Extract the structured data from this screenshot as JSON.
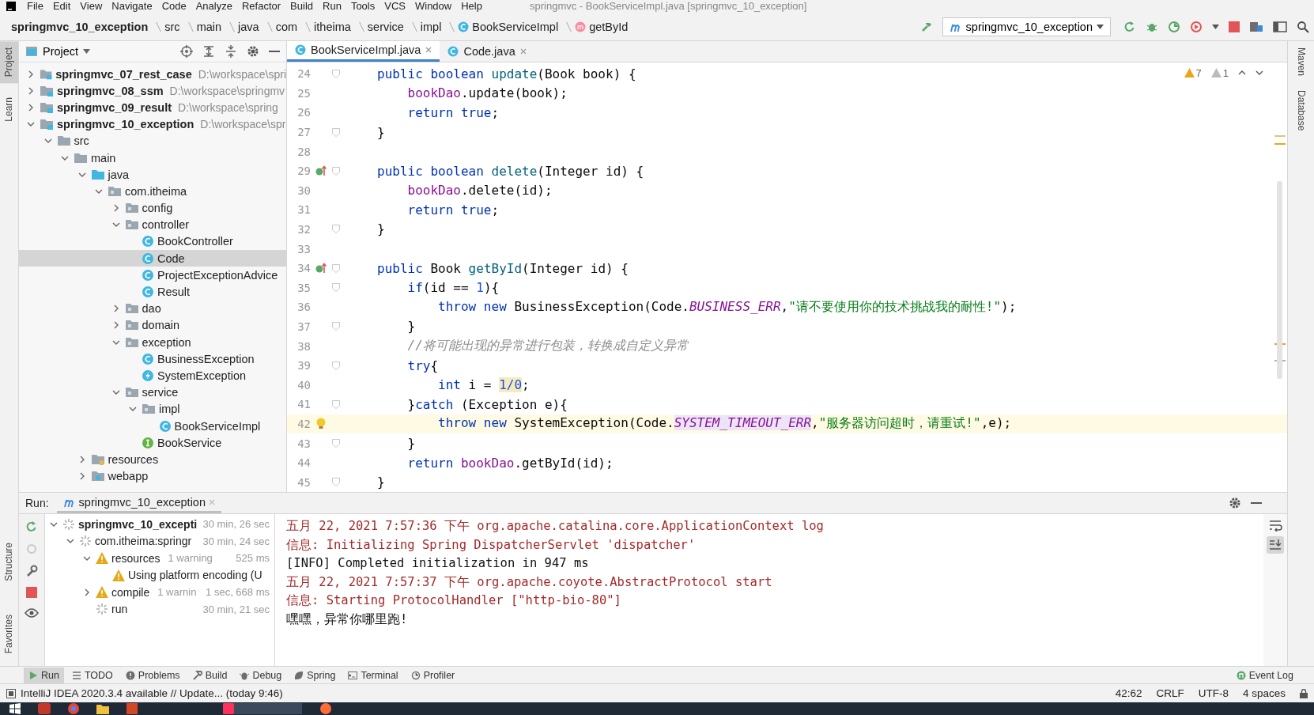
{
  "menu": {
    "items": [
      "File",
      "Edit",
      "View",
      "Navigate",
      "Code",
      "Analyze",
      "Refactor",
      "Build",
      "Run",
      "Tools",
      "VCS",
      "Window",
      "Help"
    ],
    "title": "springmvc - BookServiceImpl.java [springmvc_10_exception]"
  },
  "breadcrumbs": [
    {
      "label": "springmvc_10_exception",
      "kind": "module"
    },
    {
      "label": "src",
      "kind": "folder"
    },
    {
      "label": "main",
      "kind": "folder"
    },
    {
      "label": "java",
      "kind": "folder"
    },
    {
      "label": "com",
      "kind": "folder"
    },
    {
      "label": "itheima",
      "kind": "folder"
    },
    {
      "label": "service",
      "kind": "folder"
    },
    {
      "label": "impl",
      "kind": "folder"
    },
    {
      "label": "BookServiceImpl",
      "kind": "class"
    },
    {
      "label": "getById",
      "kind": "method"
    }
  ],
  "run_config": {
    "label": "springmvc_10_exception"
  },
  "left_tabs": [
    {
      "label": "Project",
      "selected": true
    },
    {
      "label": "Learn",
      "selected": false
    }
  ],
  "left_bottom_tabs": [
    {
      "label": "Structure",
      "selected": false
    },
    {
      "label": "Favorites",
      "selected": false
    }
  ],
  "right_tabs": [
    {
      "label": "Maven",
      "selected": false
    },
    {
      "label": "Database",
      "selected": false
    }
  ],
  "project": {
    "title": "Project",
    "tree": [
      {
        "label": "springmvc_07_rest_case",
        "path": "D:\\workspace\\spri",
        "kind": "module",
        "expanded": false,
        "selected": false
      },
      {
        "label": "springmvc_08_ssm",
        "path": "D:\\workspace\\springmv",
        "kind": "module",
        "expanded": false,
        "selected": false
      },
      {
        "label": "springmvc_09_result",
        "path": "D:\\workspace\\spring",
        "kind": "module",
        "expanded": false,
        "selected": false
      },
      {
        "label": "springmvc_10_exception",
        "path": "D:\\workspace\\spr",
        "kind": "module",
        "expanded": true,
        "selected": false,
        "children": [
          {
            "label": "src",
            "kind": "folder",
            "expanded": true,
            "selected": false,
            "children": [
              {
                "label": "main",
                "kind": "folder",
                "expanded": true,
                "selected": false,
                "children": [
                  {
                    "label": "java",
                    "kind": "source-root",
                    "expanded": true,
                    "selected": false,
                    "children": [
                      {
                        "label": "com.itheima",
                        "kind": "package",
                        "expanded": true,
                        "selected": false,
                        "children": [
                          {
                            "label": "config",
                            "kind": "package",
                            "expanded": false,
                            "selected": false
                          },
                          {
                            "label": "controller",
                            "kind": "package",
                            "expanded": true,
                            "selected": false,
                            "children": [
                              {
                                "label": "BookController",
                                "kind": "class",
                                "selected": false
                              },
                              {
                                "label": "Code",
                                "kind": "class",
                                "selected": true
                              },
                              {
                                "label": "ProjectExceptionAdvice",
                                "kind": "class",
                                "selected": false
                              },
                              {
                                "label": "Result",
                                "kind": "class",
                                "selected": false
                              }
                            ]
                          },
                          {
                            "label": "dao",
                            "kind": "package",
                            "expanded": false,
                            "selected": false
                          },
                          {
                            "label": "domain",
                            "kind": "package",
                            "expanded": false,
                            "selected": false
                          },
                          {
                            "label": "exception",
                            "kind": "package",
                            "expanded": true,
                            "selected": false,
                            "children": [
                              {
                                "label": "BusinessException",
                                "kind": "class",
                                "selected": false
                              },
                              {
                                "label": "SystemException",
                                "kind": "exception-class",
                                "selected": false
                              }
                            ]
                          },
                          {
                            "label": "service",
                            "kind": "package",
                            "expanded": true,
                            "selected": false,
                            "children": [
                              {
                                "label": "impl",
                                "kind": "package",
                                "expanded": true,
                                "selected": false,
                                "children": [
                                  {
                                    "label": "BookServiceImpl",
                                    "kind": "class",
                                    "selected": false
                                  }
                                ]
                              },
                              {
                                "label": "BookService",
                                "kind": "interface",
                                "selected": false
                              }
                            ]
                          }
                        ]
                      }
                    ]
                  },
                  {
                    "label": "resources",
                    "kind": "resources",
                    "expanded": false,
                    "selected": false
                  },
                  {
                    "label": "webapp",
                    "kind": "webapp",
                    "expanded": false,
                    "selected": false
                  }
                ]
              }
            ]
          }
        ]
      }
    ]
  },
  "editor": {
    "tabs": [
      {
        "label": "BookServiceImpl.java",
        "selected": true
      },
      {
        "label": "Code.java",
        "selected": false
      }
    ],
    "problems": {
      "warnings": "7",
      "weak_warnings": "1"
    },
    "lines": [
      {
        "no": "24",
        "fold": true,
        "current": false,
        "tokens": [
          {
            "kind": "kw",
            "text": "public boolean "
          },
          {
            "kind": "method",
            "text": "update"
          },
          {
            "kind": "plain",
            "text": "(Book book) {"
          }
        ]
      },
      {
        "no": "25",
        "fold": false,
        "current": false,
        "tokens": [
          {
            "kind": "field",
            "text": "    bookDao"
          },
          {
            "kind": "plain",
            "text": ".update(book);"
          }
        ]
      },
      {
        "no": "26",
        "fold": false,
        "current": false,
        "tokens": [
          {
            "kind": "kw",
            "text": "    return true"
          },
          {
            "kind": "plain",
            "text": ";"
          }
        ]
      },
      {
        "no": "27",
        "fold": true,
        "current": false,
        "tokens": [
          {
            "kind": "plain",
            "text": "}"
          }
        ]
      },
      {
        "no": "28",
        "fold": false,
        "current": false
      },
      {
        "no": "29",
        "fold": true,
        "current": false,
        "marker": {
          "kind": "implements"
        },
        "tokens": [
          {
            "kind": "kw",
            "text": "public boolean "
          },
          {
            "kind": "method",
            "text": "delete"
          },
          {
            "kind": "plain",
            "text": "(Integer id) {"
          }
        ]
      },
      {
        "no": "30",
        "fold": false,
        "current": false,
        "tokens": [
          {
            "kind": "field",
            "text": "    bookDao"
          },
          {
            "kind": "plain",
            "text": ".delete(id);"
          }
        ]
      },
      {
        "no": "31",
        "fold": false,
        "current": false,
        "tokens": [
          {
            "kind": "kw",
            "text": "    return true"
          },
          {
            "kind": "plain",
            "text": ";"
          }
        ]
      },
      {
        "no": "32",
        "fold": true,
        "current": false,
        "tokens": [
          {
            "kind": "plain",
            "text": "}"
          }
        ]
      },
      {
        "no": "33",
        "fold": false,
        "current": false
      },
      {
        "no": "34",
        "fold": true,
        "current": false,
        "marker": {
          "kind": "implements"
        },
        "tokens": [
          {
            "kind": "kw",
            "text": "public "
          },
          {
            "kind": "plain",
            "text": "Book "
          },
          {
            "kind": "method",
            "text": "getById"
          },
          {
            "kind": "plain",
            "text": "(Integer id) {"
          }
        ]
      },
      {
        "no": "35",
        "fold": true,
        "current": false,
        "tokens": [
          {
            "kind": "kw",
            "text": "    if"
          },
          {
            "kind": "plain",
            "text": "(id == "
          },
          {
            "kind": "num",
            "text": "1"
          },
          {
            "kind": "plain",
            "text": "){"
          }
        ]
      },
      {
        "no": "36",
        "fold": false,
        "current": false,
        "tokens": [
          {
            "kind": "kw",
            "text": "        throw new "
          },
          {
            "kind": "plain",
            "text": "BusinessException(Code."
          },
          {
            "kind": "static",
            "text": "BUSINESS_ERR"
          },
          {
            "kind": "plain",
            "text": ","
          },
          {
            "kind": "str",
            "text": "\"请不要使用你的技术挑战我的耐性!\""
          },
          {
            "kind": "plain",
            "text": ");"
          }
        ]
      },
      {
        "no": "37",
        "fold": true,
        "current": false,
        "tokens": [
          {
            "kind": "plain",
            "text": "    }"
          }
        ]
      },
      {
        "no": "38",
        "fold": false,
        "current": false,
        "tokens": [
          {
            "kind": "comment",
            "text": "    //将可能出现的异常进行包装，转换成自定义异常"
          }
        ]
      },
      {
        "no": "39",
        "fold": true,
        "current": false,
        "tokens": [
          {
            "kind": "kw",
            "text": "    try"
          },
          {
            "kind": "plain",
            "text": "{"
          }
        ]
      },
      {
        "no": "40",
        "fold": false,
        "current": false,
        "tokens": [
          {
            "kind": "kw",
            "text": "        int "
          },
          {
            "kind": "plain",
            "text": "i = "
          },
          {
            "kind": "num-warning",
            "text": "1/0"
          },
          {
            "kind": "plain",
            "text": ";"
          }
        ]
      },
      {
        "no": "41",
        "fold": true,
        "current": false,
        "tokens": [
          {
            "kind": "plain",
            "text": "    }"
          },
          {
            "kind": "kw",
            "text": "catch "
          },
          {
            "kind": "plain",
            "text": "(Exception e){"
          }
        ]
      },
      {
        "no": "42",
        "fold": false,
        "current": true,
        "marker": {
          "kind": "bulb"
        },
        "tokens": [
          {
            "kind": "kw",
            "text": "        throw new "
          },
          {
            "kind": "plain",
            "text": "SystemException(Code."
          },
          {
            "kind": "static-usage",
            "text": "SYSTEM_TIMEOUT_ERR"
          },
          {
            "kind": "plain",
            "text": ","
          },
          {
            "kind": "str",
            "text": "\"服务器访问超时，请重试!\""
          },
          {
            "kind": "plain",
            "text": ",e);"
          }
        ]
      },
      {
        "no": "43",
        "fold": true,
        "current": false,
        "tokens": [
          {
            "kind": "plain",
            "text": "    }"
          }
        ]
      },
      {
        "no": "44",
        "fold": false,
        "current": false,
        "tokens": [
          {
            "kind": "kw",
            "text": "    return "
          },
          {
            "kind": "field",
            "text": "bookDao"
          },
          {
            "kind": "plain",
            "text": ".getById(id);"
          }
        ]
      },
      {
        "no": "45",
        "fold": true,
        "current": false,
        "tokens": [
          {
            "kind": "plain",
            "text": "}"
          }
        ]
      }
    ]
  },
  "run": {
    "label": "Run:",
    "tab": "springmvc_10_exception",
    "tree": [
      {
        "label": "springmvc_10_excepti",
        "time": "30 min, 26 sec",
        "kind": "running",
        "expanded": true,
        "children": [
          {
            "label": "com.itheima:springr",
            "time": "30 min, 24 sec",
            "kind": "running",
            "expanded": true,
            "children": [
              {
                "label": "resources",
                "note": "1 warning",
                "time": "525 ms",
                "kind": "warning",
                "expanded": true,
                "children": [
                  {
                    "label": "Using platform encoding (U",
                    "kind": "warning"
                  }
                ]
              },
              {
                "label": "compile",
                "note": "1 warnin",
                "time": "1 sec, 668 ms",
                "kind": "warning",
                "expanded": false
              },
              {
                "label": "run",
                "time": "30 min, 21 sec",
                "kind": "running"
              }
            ]
          }
        ]
      }
    ],
    "console": [
      {
        "kind": "stderr",
        "text": "五月 22, 2021 7:57:36 下午 org.apache.catalina.core.ApplicationContext log"
      },
      {
        "kind": "stderr",
        "text": "信息: Initializing Spring DispatcherServlet 'dispatcher'"
      },
      {
        "kind": "stdout",
        "text": "[INFO] Completed initialization in 947 ms"
      },
      {
        "kind": "stderr",
        "text": "五月 22, 2021 7:57:37 下午 org.apache.coyote.AbstractProtocol start"
      },
      {
        "kind": "stderr",
        "text": "信息: Starting ProtocolHandler [\"http-bio-80\"]"
      },
      {
        "kind": "stdout",
        "text": "嘿嘿，异常你哪里跑!"
      }
    ]
  },
  "tool_windows": [
    {
      "label": "Run",
      "kind": "run",
      "selected": true
    },
    {
      "label": "TODO",
      "kind": "todo",
      "selected": false
    },
    {
      "label": "Problems",
      "kind": "problems",
      "selected": false
    },
    {
      "label": "Build",
      "kind": "build",
      "selected": false
    },
    {
      "label": "Debug",
      "kind": "debug",
      "selected": false
    },
    {
      "label": "Spring",
      "kind": "spring",
      "selected": false
    },
    {
      "label": "Terminal",
      "kind": "terminal",
      "selected": false
    },
    {
      "label": "Profiler",
      "kind": "profiler",
      "selected": false
    }
  ],
  "event_log": "Event Log",
  "status": {
    "message": "IntelliJ IDEA 2020.3.4 available // Update... (today 9:46)",
    "position": "42:62",
    "line_sep": "CRLF",
    "encoding": "UTF-8",
    "indent": "4 spaces"
  }
}
